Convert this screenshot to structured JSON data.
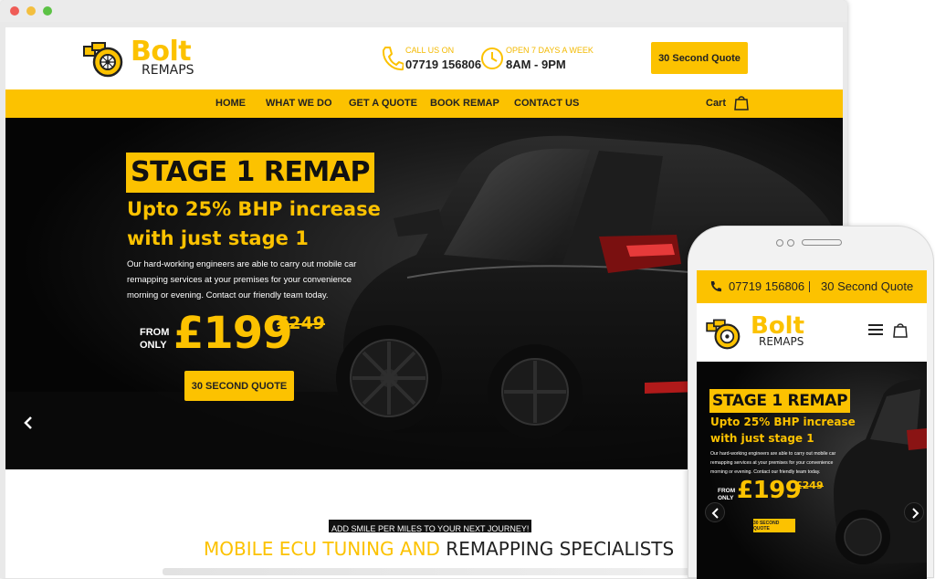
{
  "site": {
    "brand_word1": "Bolt",
    "brand_word2": "REMAPS",
    "call_label": "CALL US ON",
    "phone": "07719 156806",
    "hours_label": "OPEN 7 DAYS A WEEK",
    "hours": "8AM - 9PM",
    "top_quote_button": "30 Second Quote",
    "nav": [
      "HOME",
      "WHAT WE DO",
      "GET A QUOTE",
      "BOOK REMAP",
      "CONTACT US"
    ],
    "cart_label": "Cart"
  },
  "hero": {
    "title": "STAGE 1 REMAP",
    "subtitle": "Upto 25% BHP increase with just stage 1",
    "description": "Our hard-working engineers are able to carry out mobile car remapping services at your premises for your convenience morning or evening. Contact our friendly team today.",
    "from_label_1": "FROM",
    "from_label_2": "ONLY",
    "price": "£199",
    "old_price": "£249",
    "button": "30 SECOND QUOTE"
  },
  "section": {
    "tagline": "ADD SMILE PER MILES TO YOUR NEXT JOURNEY!",
    "title_highlight": "MOBILE ECU TUNING AND",
    "title_rest": "REMAPPING SPECIALISTS"
  },
  "mobile": {
    "phone": "07719 156806",
    "quote": "30 Second Quote",
    "brand_word1": "Bolt",
    "brand_word2": "REMAPS",
    "title": "STAGE 1 REMAP",
    "subtitle": "Upto 25% BHP increase with just stage 1",
    "description": "Our hard-working engineers are able to carry out mobile car remapping services at your premises for your convenience morning or evening. Contact our friendly team today.",
    "from_label_1": "FROM",
    "from_label_2": "ONLY",
    "price": "£199",
    "old_price": "£249",
    "button": "30 SECOND QUOTE"
  },
  "colors": {
    "accent": "#fcc200",
    "dark": "#111111",
    "text": "#222222"
  }
}
